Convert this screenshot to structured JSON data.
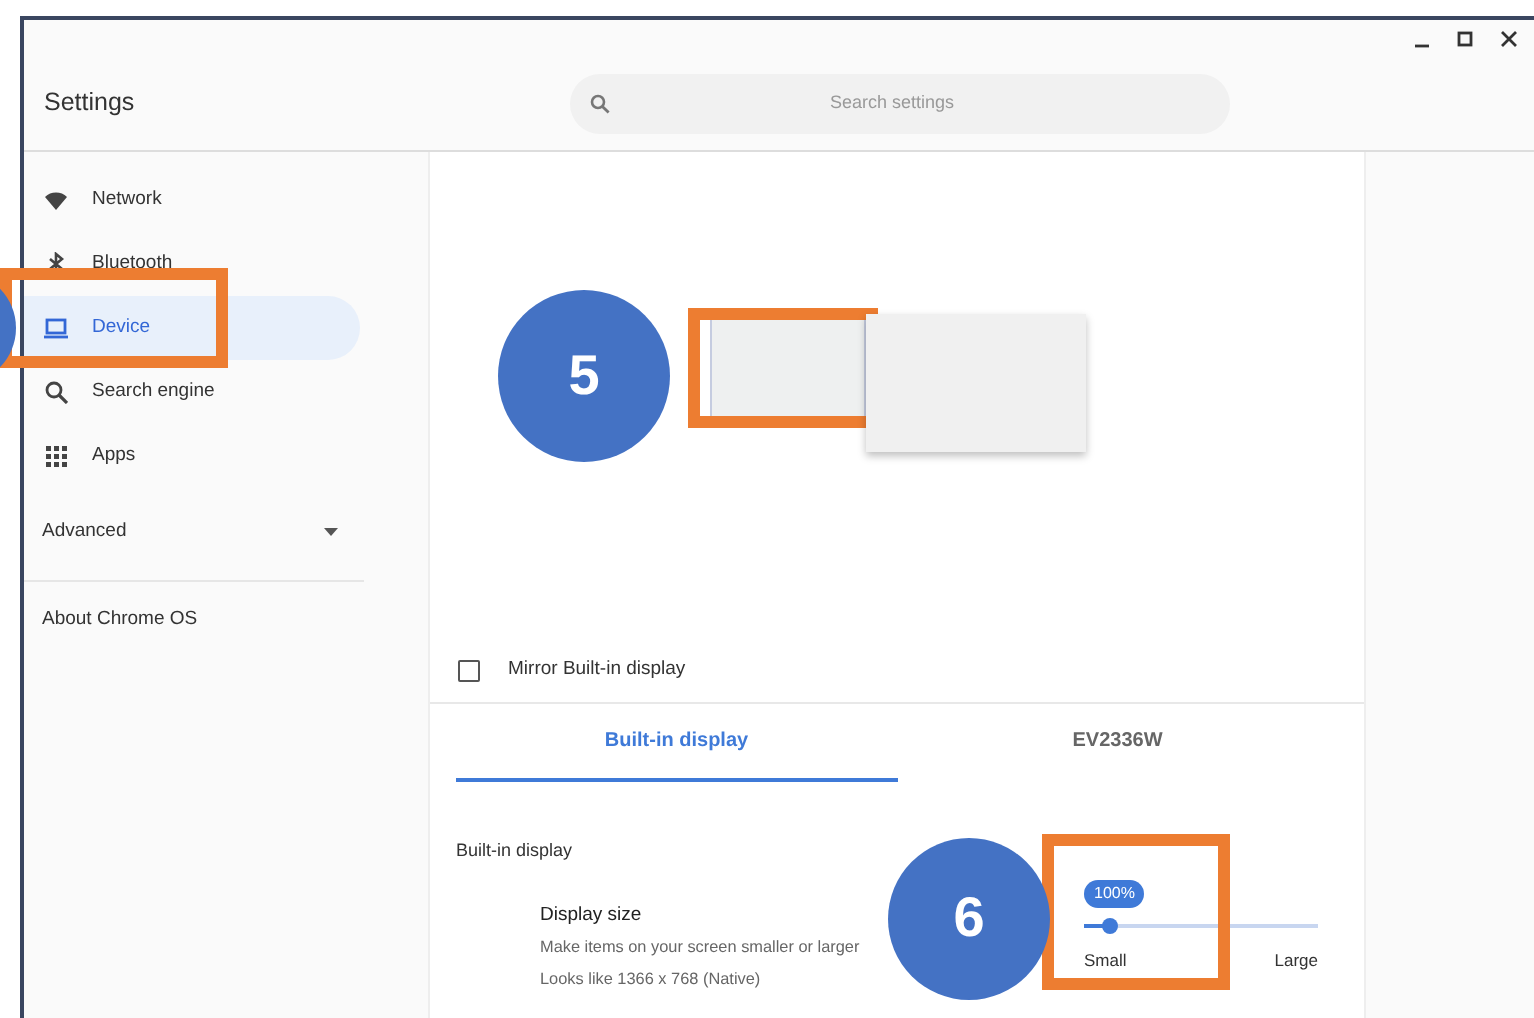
{
  "window": {
    "title": "Settings"
  },
  "search": {
    "placeholder": "Search settings"
  },
  "sidebar": {
    "items": [
      {
        "label": "Network",
        "kind": "wifi",
        "selected": false,
        "highlighted": false
      },
      {
        "label": "Bluetooth",
        "kind": "bluetooth",
        "selected": false,
        "highlighted": false
      },
      {
        "label": "Device",
        "kind": "laptop",
        "selected": true,
        "highlighted": true,
        "callout_cut": true
      },
      {
        "label": "Search engine",
        "kind": "search",
        "selected": false,
        "highlighted": false
      },
      {
        "label": "Apps",
        "kind": "apps",
        "selected": false,
        "highlighted": false
      }
    ],
    "advanced": {
      "label": "Advanced",
      "expanded": false
    },
    "about": "About Chrome OS"
  },
  "displays": {
    "arrangement": [
      {
        "kind": "primary",
        "highlighted": true,
        "callout": "5"
      },
      {
        "kind": "secondary",
        "highlighted": false
      }
    ],
    "mirror": {
      "label": "Mirror Built-in display",
      "checked": false
    },
    "tabs": [
      {
        "label": "Built-in display",
        "selected": true
      },
      {
        "label": "EV2336W",
        "selected": false
      }
    ],
    "section_title": "Built-in display",
    "display_size": {
      "title": "Display size",
      "description": "Make items on your screen smaller or larger",
      "resolution": "Looks like 1366 x 768 (Native)",
      "slider": {
        "value_bubble": "100%",
        "level": 0.11,
        "min_label": "Small",
        "max_label": "Large",
        "highlighted": true,
        "callout": "6"
      }
    }
  }
}
